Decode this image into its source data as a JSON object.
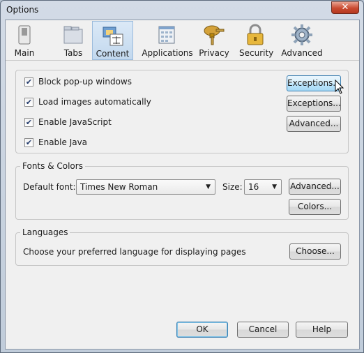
{
  "window": {
    "title": "Options",
    "close_glyph": "✕"
  },
  "tabs": [
    {
      "label": "Main",
      "icon": "switch-icon",
      "selected": false
    },
    {
      "label": "Tabs",
      "icon": "folder-tabs-icon",
      "selected": false
    },
    {
      "label": "Content",
      "icon": "content-page-icon",
      "selected": true
    },
    {
      "label": "Applications",
      "icon": "applications-icon",
      "selected": false
    },
    {
      "label": "Privacy",
      "icon": "key-mask-icon",
      "selected": false
    },
    {
      "label": "Security",
      "icon": "padlock-icon",
      "selected": false
    },
    {
      "label": "Advanced",
      "icon": "gear-icon",
      "selected": false
    }
  ],
  "content": {
    "options": [
      {
        "label": "Block pop-up windows",
        "checked": true
      },
      {
        "label": "Load images automatically",
        "checked": true
      },
      {
        "label": "Enable JavaScript",
        "checked": true
      },
      {
        "label": "Enable Java",
        "checked": true
      }
    ],
    "buttons": {
      "popup_exceptions": "Exceptions...",
      "images_exceptions": "Exceptions...",
      "js_advanced": "Advanced..."
    }
  },
  "fonts": {
    "legend": "Fonts & Colors",
    "default_font_label": "Default font:",
    "default_font_value": "Times New Roman",
    "size_label": "Size:",
    "size_value": "16",
    "advanced_button": "Advanced...",
    "colors_button": "Colors..."
  },
  "languages": {
    "legend": "Languages",
    "description": "Choose your preferred language for displaying pages",
    "choose_button": "Choose..."
  },
  "footer": {
    "ok": "OK",
    "cancel": "Cancel",
    "help": "Help"
  },
  "colors": {
    "check": "#223a6b",
    "selected_tab": "#c2d8ee",
    "close": "#c94a30"
  }
}
